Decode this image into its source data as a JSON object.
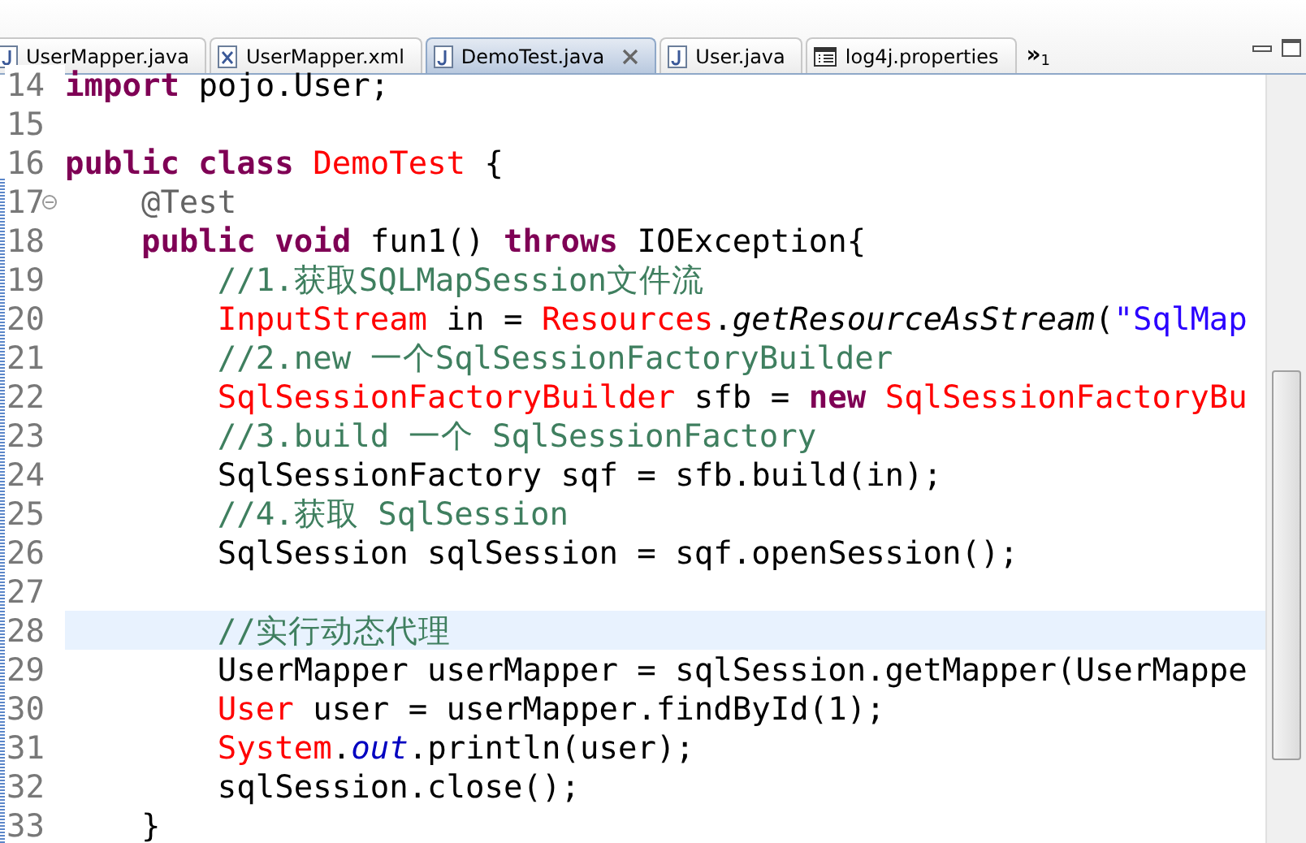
{
  "tabs": [
    {
      "label": "UserMapper.java",
      "kind": "java",
      "selected": false
    },
    {
      "label": "UserMapper.xml",
      "kind": "xml",
      "selected": false
    },
    {
      "label": "DemoTest.java",
      "kind": "java",
      "selected": true
    },
    {
      "label": "User.java",
      "kind": "java",
      "selected": false
    },
    {
      "label": "log4j.properties",
      "kind": "properties",
      "selected": false
    }
  ],
  "overflow": {
    "chevron": "»",
    "count": "1"
  },
  "lines": [
    {
      "number": "14",
      "highlighted": false,
      "tokens": [
        {
          "kind": "keyword",
          "text": "import"
        },
        {
          "kind": "plain",
          "text": " pojo.User;"
        }
      ]
    },
    {
      "number": "15",
      "highlighted": false
    },
    {
      "number": "16",
      "highlighted": false,
      "tokens": [
        {
          "kind": "keyword",
          "text": "public class "
        },
        {
          "kind": "type",
          "text": "DemoTest"
        },
        {
          "kind": "plain",
          "text": " {"
        }
      ],
      "children": [
        {
          "number": "17",
          "highlighted": false,
          "folded": false,
          "tokens": [
            {
              "kind": "annotation",
              "text": "@Test"
            }
          ]
        },
        {
          "number": "18",
          "highlighted": false,
          "tokens": [
            {
              "kind": "keyword",
              "text": "public void"
            },
            {
              "kind": "plain",
              "text": " fun1() "
            },
            {
              "kind": "keyword",
              "text": "throws"
            },
            {
              "kind": "plain",
              "text": " IOException{"
            }
          ],
          "children": [
            {
              "number": "19",
              "highlighted": false,
              "tokens": [
                {
                  "kind": "comment",
                  "text": "//1.获取SQLMapSession文件流"
                }
              ]
            },
            {
              "number": "20",
              "highlighted": false,
              "tokens": [
                {
                  "kind": "type",
                  "text": "InputStream"
                },
                {
                  "kind": "plain",
                  "text": " in = "
                },
                {
                  "kind": "type",
                  "text": "Resources"
                },
                {
                  "kind": "plain",
                  "text": "."
                },
                {
                  "kind": "static",
                  "text": "getResourceAsStream"
                },
                {
                  "kind": "plain",
                  "text": "("
                },
                {
                  "kind": "string",
                  "text": "\"SqlMap"
                }
              ]
            },
            {
              "number": "21",
              "highlighted": false,
              "tokens": [
                {
                  "kind": "comment",
                  "text": "//2.new 一个SqlSessionFactoryBuilder"
                }
              ]
            },
            {
              "number": "22",
              "highlighted": false,
              "tokens": [
                {
                  "kind": "type",
                  "text": "SqlSessionFactoryBuilder"
                },
                {
                  "kind": "plain",
                  "text": " sfb = "
                },
                {
                  "kind": "keyword",
                  "text": "new "
                },
                {
                  "kind": "type",
                  "text": "SqlSessionFactoryBu"
                }
              ]
            },
            {
              "number": "23",
              "highlighted": false,
              "tokens": [
                {
                  "kind": "comment",
                  "text": "//3.build 一个 SqlSessionFactory"
                }
              ]
            },
            {
              "number": "24",
              "highlighted": false,
              "tokens": [
                {
                  "kind": "plain",
                  "text": "SqlSessionFactory sqf = sfb.build(in);"
                }
              ]
            },
            {
              "number": "25",
              "highlighted": false,
              "tokens": [
                {
                  "kind": "comment",
                  "text": "//4.获取 SqlSession"
                }
              ]
            },
            {
              "number": "26",
              "highlighted": false,
              "tokens": [
                {
                  "kind": "plain",
                  "text": "SqlSession sqlSession = sqf.openSession();"
                }
              ]
            },
            {
              "number": "27",
              "highlighted": false
            },
            {
              "number": "28",
              "highlighted": true,
              "tokens": [
                {
                  "kind": "comment",
                  "text": "//实行动态代理"
                }
              ]
            },
            {
              "number": "29",
              "highlighted": false,
              "tokens": [
                {
                  "kind": "plain",
                  "text": "UserMapper userMapper = sqlSession.getMapper(UserMappe"
                }
              ]
            },
            {
              "number": "30",
              "highlighted": false,
              "tokens": [
                {
                  "kind": "type",
                  "text": "User"
                },
                {
                  "kind": "plain",
                  "text": " user = userMapper.findById(1);"
                }
              ]
            },
            {
              "number": "31",
              "highlighted": false,
              "tokens": [
                {
                  "kind": "type",
                  "text": "System"
                },
                {
                  "kind": "plain",
                  "text": "."
                },
                {
                  "kind": "field",
                  "text": "out"
                },
                {
                  "kind": "plain",
                  "text": ".println(user);"
                }
              ]
            },
            {
              "number": "32",
              "highlighted": false,
              "tokens": [
                {
                  "kind": "plain",
                  "text": "sqlSession.close();"
                }
              ]
            }
          ]
        },
        {
          "number": "33",
          "highlighted": false,
          "tokens": [
            {
              "kind": "plain",
              "text": "}"
            }
          ]
        }
      ]
    }
  ]
}
